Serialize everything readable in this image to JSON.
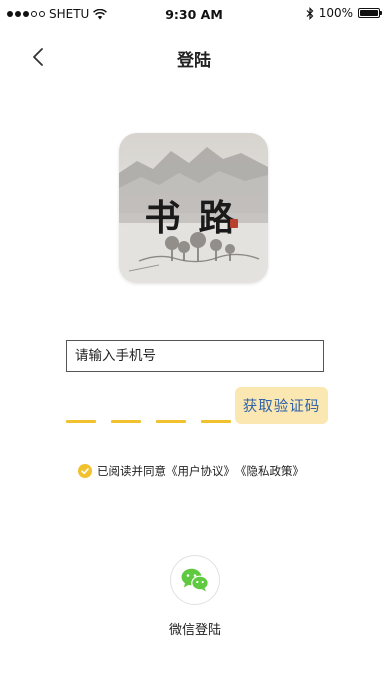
{
  "status_bar": {
    "carrier": "SHETU",
    "time": "9:30 AM",
    "battery": "100%",
    "signal_dots_filled": 3,
    "signal_dots_total": 5
  },
  "header": {
    "title": "登陆",
    "back_icon": "chevron-left-icon"
  },
  "logo": {
    "text": "书路"
  },
  "form": {
    "phone_placeholder": "请输入手机号",
    "get_code_label": "获取验证码",
    "code_slot_count": 4
  },
  "agreement": {
    "checked": true,
    "prefix": "已阅读并同意",
    "user_agreement": "《用户协议》",
    "privacy_policy": "《隐私政策》"
  },
  "wechat_login": {
    "label": "微信登陆",
    "icon": "wechat-icon"
  },
  "colors": {
    "accent_yellow": "#f2c12e",
    "button_bg": "#fbe7b2",
    "button_text": "#2f62a8",
    "wechat_green": "#5fc940"
  }
}
